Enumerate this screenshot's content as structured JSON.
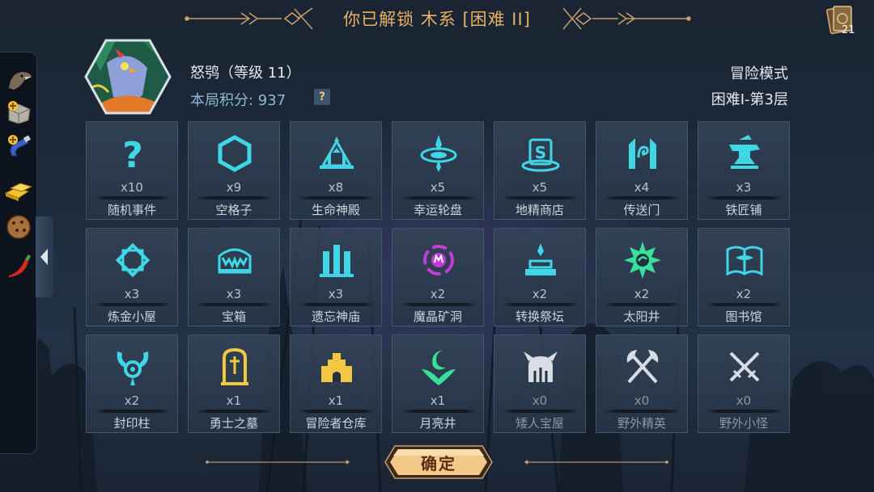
{
  "header": {
    "title": "你已解锁 木系 [困难 II]"
  },
  "cards": {
    "count": "21",
    "icon": "card-deck-icon"
  },
  "sidebar": {
    "items": [
      {
        "name": "raven-head-relic",
        "icon": "raven-head-icon"
      },
      {
        "name": "stone-block-upgrade",
        "icon": "stone-plus-icon"
      },
      {
        "name": "magnet-upgrade",
        "icon": "magnet-plus-icon"
      },
      {
        "name": "gold-bars",
        "icon": "gold-bars-icon"
      },
      {
        "name": "cookie",
        "icon": "cookie-icon"
      },
      {
        "name": "chili-pepper",
        "icon": "chili-icon"
      }
    ]
  },
  "hero": {
    "name": "怒鸮（等级 11）",
    "score_label": "本局积分: 937",
    "help": "?"
  },
  "mode": {
    "label": "冒险模式",
    "floor": "困难Ⅰ-第3层"
  },
  "rooms": [
    {
      "label": "随机事件",
      "count": "x10",
      "icon": "question-mark-icon",
      "color": "#3fd6e6"
    },
    {
      "label": "空格子",
      "count": "x9",
      "icon": "hexagon-icon",
      "color": "#3fd6e6"
    },
    {
      "label": "生命神殿",
      "count": "x8",
      "icon": "life-temple-icon",
      "color": "#3fd6e6"
    },
    {
      "label": "幸运轮盘",
      "count": "x5",
      "icon": "lucky-wheel-icon",
      "color": "#3fd6e6"
    },
    {
      "label": "地精商店",
      "count": "x5",
      "icon": "goblin-shop-icon",
      "color": "#3fd6e6"
    },
    {
      "label": "传送门",
      "count": "x4",
      "icon": "portal-icon",
      "color": "#3fd6e6"
    },
    {
      "label": "铁匠铺",
      "count": "x3",
      "icon": "anvil-icon",
      "color": "#3fd6e6"
    },
    {
      "label": "炼金小屋",
      "count": "x3",
      "icon": "alchemy-hut-icon",
      "color": "#3fd6e6"
    },
    {
      "label": "宝箱",
      "count": "x3",
      "icon": "treasure-chest-icon",
      "color": "#3fd6e6"
    },
    {
      "label": "遗忘神庙",
      "count": "x3",
      "icon": "forgotten-temple-icon",
      "color": "#3fd6e6"
    },
    {
      "label": "魔晶矿洞",
      "count": "x2",
      "icon": "crystal-mine-icon",
      "color": "#c23cd8"
    },
    {
      "label": "转换祭坛",
      "count": "x2",
      "icon": "conversion-altar-icon",
      "color": "#3fd6e6"
    },
    {
      "label": "太阳井",
      "count": "x2",
      "icon": "sun-well-icon",
      "color": "#39e09a"
    },
    {
      "label": "图书馆",
      "count": "x2",
      "icon": "library-book-icon",
      "color": "#3fd6e6"
    },
    {
      "label": "封印柱",
      "count": "x2",
      "icon": "seal-pillar-icon",
      "color": "#3fd6e6"
    },
    {
      "label": "勇士之墓",
      "count": "x1",
      "icon": "warrior-tomb-icon",
      "color": "#f2c742"
    },
    {
      "label": "冒险者仓库",
      "count": "x1",
      "icon": "adventurer-warehouse-icon",
      "color": "#f2c742"
    },
    {
      "label": "月亮井",
      "count": "x1",
      "icon": "moon-well-icon",
      "color": "#39e09a"
    },
    {
      "label": "矮人宝屋",
      "count": "x0",
      "icon": "dwarf-treasury-icon",
      "color": "#d8dde3"
    },
    {
      "label": "野外精英",
      "count": "x0",
      "icon": "crossed-axes-icon",
      "color": "#d8dde3"
    },
    {
      "label": "野外小怪",
      "count": "x0",
      "icon": "crossed-swords-icon",
      "color": "#d8dde3"
    }
  ],
  "confirm": {
    "label": "确定"
  },
  "colors": {
    "title": "#e8b063",
    "accent": "#3fd6e6",
    "score": "#8fb8d8",
    "button": "#f3c98a"
  }
}
